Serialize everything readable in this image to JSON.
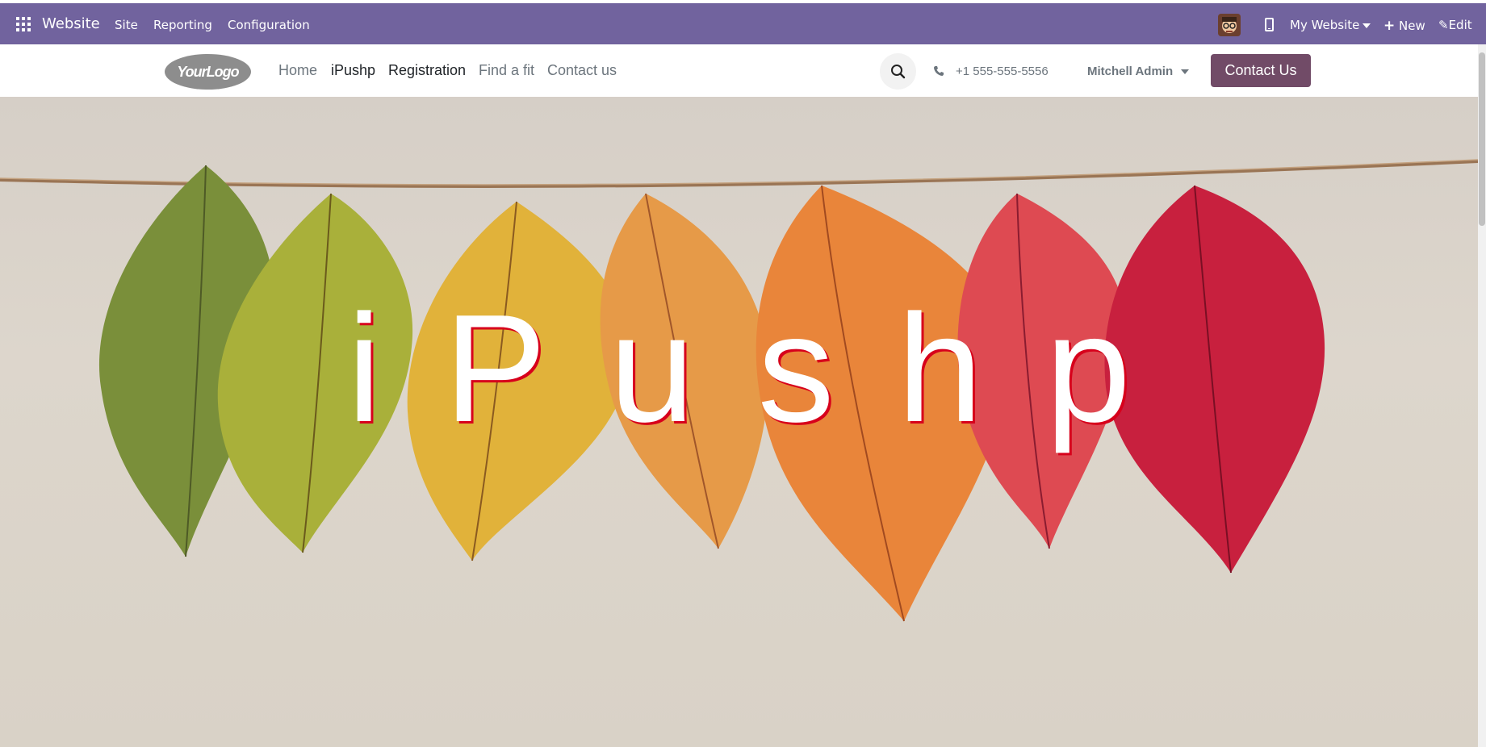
{
  "topbar": {
    "app_name": "Website",
    "menu": [
      "Site",
      "Reporting",
      "Configuration"
    ],
    "website_selector": "My Website",
    "new_label": "New",
    "edit_label": "Edit"
  },
  "site": {
    "logo_text": "YourLogo",
    "nav": [
      "Home",
      "iPushp",
      "Registration",
      "Find a fit",
      "Contact us"
    ],
    "phone": "+1 555-555-5556",
    "user": "Mitchell Admin",
    "contact_button": "Contact Us"
  },
  "hero": {
    "title": "iPushp"
  },
  "colors": {
    "topbar": "#71639e",
    "contact_button": "#714b67",
    "hero_title_shadow": "#d7001b"
  }
}
